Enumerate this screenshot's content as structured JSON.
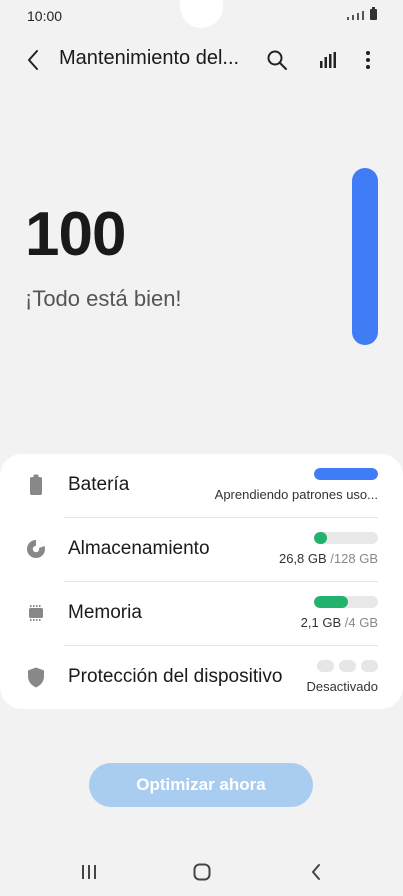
{
  "status_bar": {
    "time": "10:00"
  },
  "app_bar": {
    "title": "Mantenimiento del..."
  },
  "summary": {
    "score": "100",
    "message": "¡Todo está bien!"
  },
  "items": [
    {
      "label": "Batería",
      "value": "Aprendiendo patrones uso...",
      "value_muted": "",
      "fill": 1.0,
      "color": "#3f7cf5"
    },
    {
      "label": "Almacenamiento",
      "value": "26,8 GB",
      "value_muted": " /128 GB",
      "fill": 0.21,
      "color": "#23b26d"
    },
    {
      "label": "Memoria",
      "value": "2,1 GB",
      "value_muted": " /4 GB",
      "fill": 0.53,
      "color": "#23b26d"
    },
    {
      "label": "Protección del dispositivo",
      "value": "Desactivado",
      "value_muted": ""
    }
  ],
  "optimize_button": "Optimizar ahora",
  "colors": {
    "accent": "#3f7cf5",
    "green": "#23b26d",
    "button": "#a9cdf0"
  }
}
